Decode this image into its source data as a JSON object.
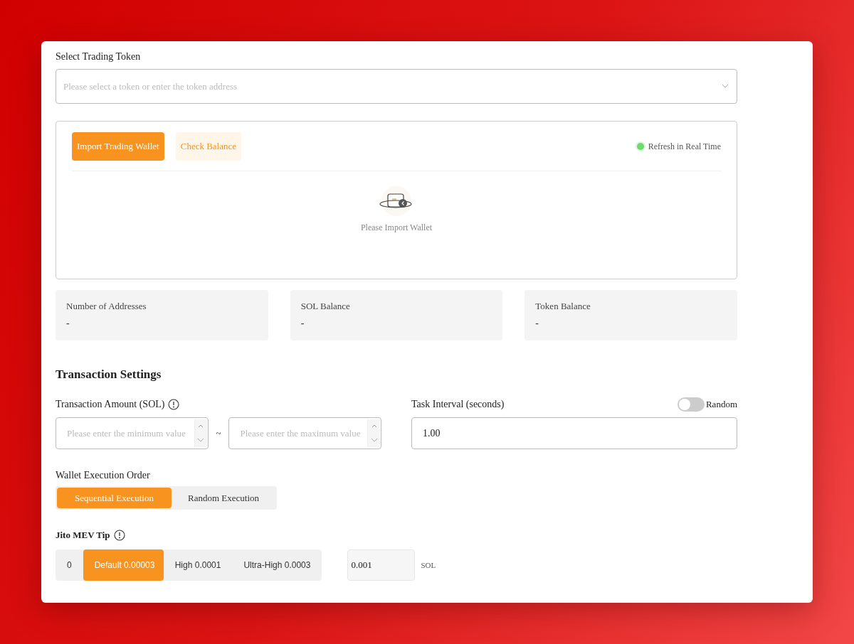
{
  "token_select": {
    "label": "Select Trading Token",
    "placeholder": "Please select a token or enter the token address"
  },
  "wallet_panel": {
    "buttons": [
      {
        "label": "Import Trading Wallet",
        "kind": "primary"
      },
      {
        "label": "Check Balance",
        "kind": "secondary"
      }
    ],
    "refresh": {
      "label": "Refresh in Real Time",
      "on": true
    },
    "empty_text": "Please Import Wallet"
  },
  "stats": [
    {
      "label": "Number of Addresses",
      "value": "-"
    },
    {
      "label": "SOL Balance",
      "value": "-"
    },
    {
      "label": "Token Balance",
      "value": "-"
    }
  ],
  "transaction_settings": {
    "title": "Transaction Settings",
    "amount": {
      "label": "Transaction Amount (SOL)",
      "min_placeholder": "Please enter the minimum value",
      "separator": "~",
      "max_placeholder": "Please enter the maximum value"
    },
    "interval": {
      "label": "Task Interval (seconds)",
      "value": "1.00",
      "random": {
        "label": "Random",
        "on": false
      }
    },
    "execution_order": {
      "label": "Wallet Execution Order",
      "options": [
        {
          "label": "Sequential Execution",
          "selected": true
        },
        {
          "label": "Random Execution",
          "selected": false
        }
      ]
    },
    "jito_tip": {
      "label": "Jito MEV Tip",
      "options": [
        {
          "label": "0",
          "selected": false
        },
        {
          "label": "Default 0.00003",
          "selected": true
        },
        {
          "label": "High 0.0001",
          "selected": false
        },
        {
          "label": "Ultra-High 0.0003",
          "selected": false
        }
      ],
      "custom_value": "0.001",
      "unit": "SOL"
    }
  }
}
